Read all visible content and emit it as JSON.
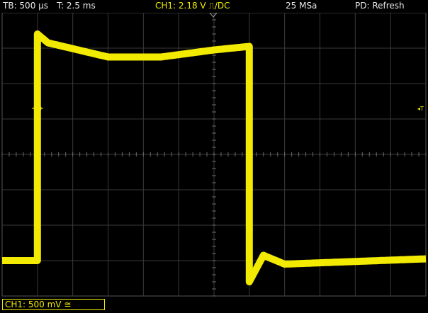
{
  "status_bar": {
    "timebase": "TB: 500 µs",
    "trigger_time": "T: 2.5 ms",
    "channel": "CH1: 2.18 V ⎍/DC",
    "sample_rate": "25 MSa",
    "mode": "PD: Refresh"
  },
  "channel_bar": {
    "ch1_label": "CH1: 500 mV ≅"
  },
  "markers": {
    "trigger_level_label": "◂T"
  },
  "colors": {
    "trace": "#f2ea00",
    "grid": "#3a3a3a",
    "background": "#000000",
    "text": "#e6e6e6"
  },
  "chart_data": {
    "type": "line",
    "title": "",
    "xlabel": "",
    "ylabel": "",
    "x_divisions": 12,
    "y_divisions": 8,
    "grid": true,
    "waveform": "pulse",
    "series": [
      {
        "x_div": [
          0,
          1.0,
          1.0,
          1.3,
          3.0,
          4.5,
          6.0,
          7.0,
          7.0,
          7.4,
          8.0,
          12.0
        ],
        "y_div": [
          -3.0,
          -3.0,
          3.4,
          3.15,
          2.75,
          2.75,
          2.95,
          3.05,
          -3.6,
          -2.85,
          -3.1,
          -2.95
        ]
      }
    ]
  }
}
